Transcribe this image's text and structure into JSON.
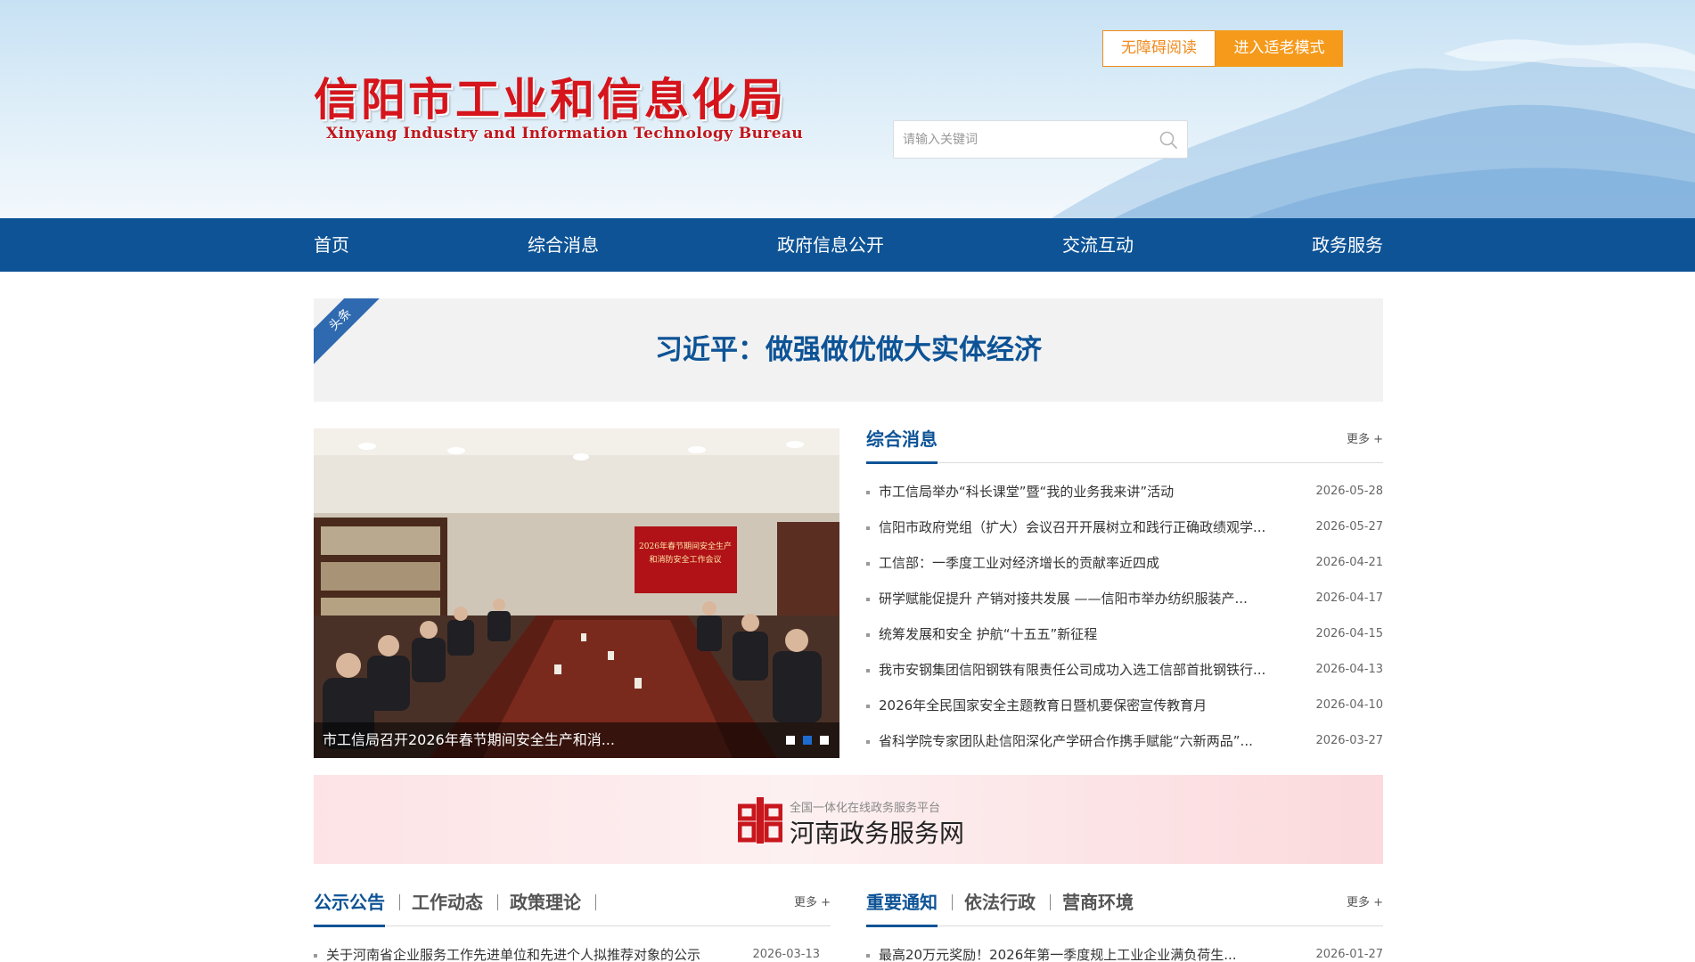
{
  "header": {
    "logo_cn": "信阳市工业和信息化局",
    "logo_en": "Xinyang Industry and Information Technology Bureau",
    "accessible_btn": "无障碍阅读",
    "elderly_btn": "进入适老模式",
    "search_placeholder": "请输入关键词"
  },
  "nav": {
    "items": [
      {
        "label": "首页"
      },
      {
        "label": "综合消息"
      },
      {
        "label": "政府信息公开"
      },
      {
        "label": "交流互动"
      },
      {
        "label": "政务服务"
      }
    ]
  },
  "headline": {
    "ribbon": "头条",
    "title": "习近平：做强做优做大实体经济"
  },
  "slider": {
    "caption": "市工信局召开2026年春节期间安全生产和消...",
    "screen_title": "2026年春节期间安全生产和消防安全工作会议",
    "dots_count": 3,
    "active_dot": 2
  },
  "news_panel": {
    "tab": "综合消息",
    "more": "更多 +",
    "items": [
      {
        "title": "市工信局举办“科长课堂”暨“我的业务我来讲”活动",
        "date": "2026-05-28"
      },
      {
        "title": "信阳市政府党组（扩大）会议召开开展树立和践行正确政绩观学...",
        "date": "2026-05-27"
      },
      {
        "title": "工信部：一季度工业对经济增长的贡献率近四成",
        "date": "2026-04-21"
      },
      {
        "title": "研学赋能促提升 产销对接共发展 ——信阳市举办纺织服装产...",
        "date": "2026-04-17"
      },
      {
        "title": "统筹发展和安全 护航“十五五”新征程",
        "date": "2026-04-15"
      },
      {
        "title": "我市安钢集团信阳钢铁有限责任公司成功入选工信部首批钢铁行...",
        "date": "2026-04-13"
      },
      {
        "title": "2026年全民国家安全主题教育日暨机要保密宣传教育月",
        "date": "2026-04-10"
      },
      {
        "title": "省科学院专家团队赴信阳深化产学研合作携手赋能“六新两品”...",
        "date": "2026-03-27"
      }
    ]
  },
  "banner": {
    "subtitle": "全国一体化在线政务服务平台",
    "title": "河南政务服务网"
  },
  "bottom_left": {
    "tabs": [
      "公示公告",
      "工作动态",
      "政策理论"
    ],
    "more": "更多 +",
    "items": [
      {
        "title": "关于河南省企业服务工作先进单位和先进个人拟推荐对象的公示",
        "date": "2026-03-13"
      }
    ]
  },
  "bottom_right": {
    "tabs": [
      "重要通知",
      "依法行政",
      "营商环境"
    ],
    "more": "更多 +",
    "items": [
      {
        "title": "最高20万元奖励！2026年第一季度规上工业企业满负荷生...",
        "date": "2026-01-27"
      }
    ]
  },
  "colors": {
    "primary": "#0d5396",
    "logo_red": "#d5141b",
    "accent_orange": "#f59a1b"
  }
}
